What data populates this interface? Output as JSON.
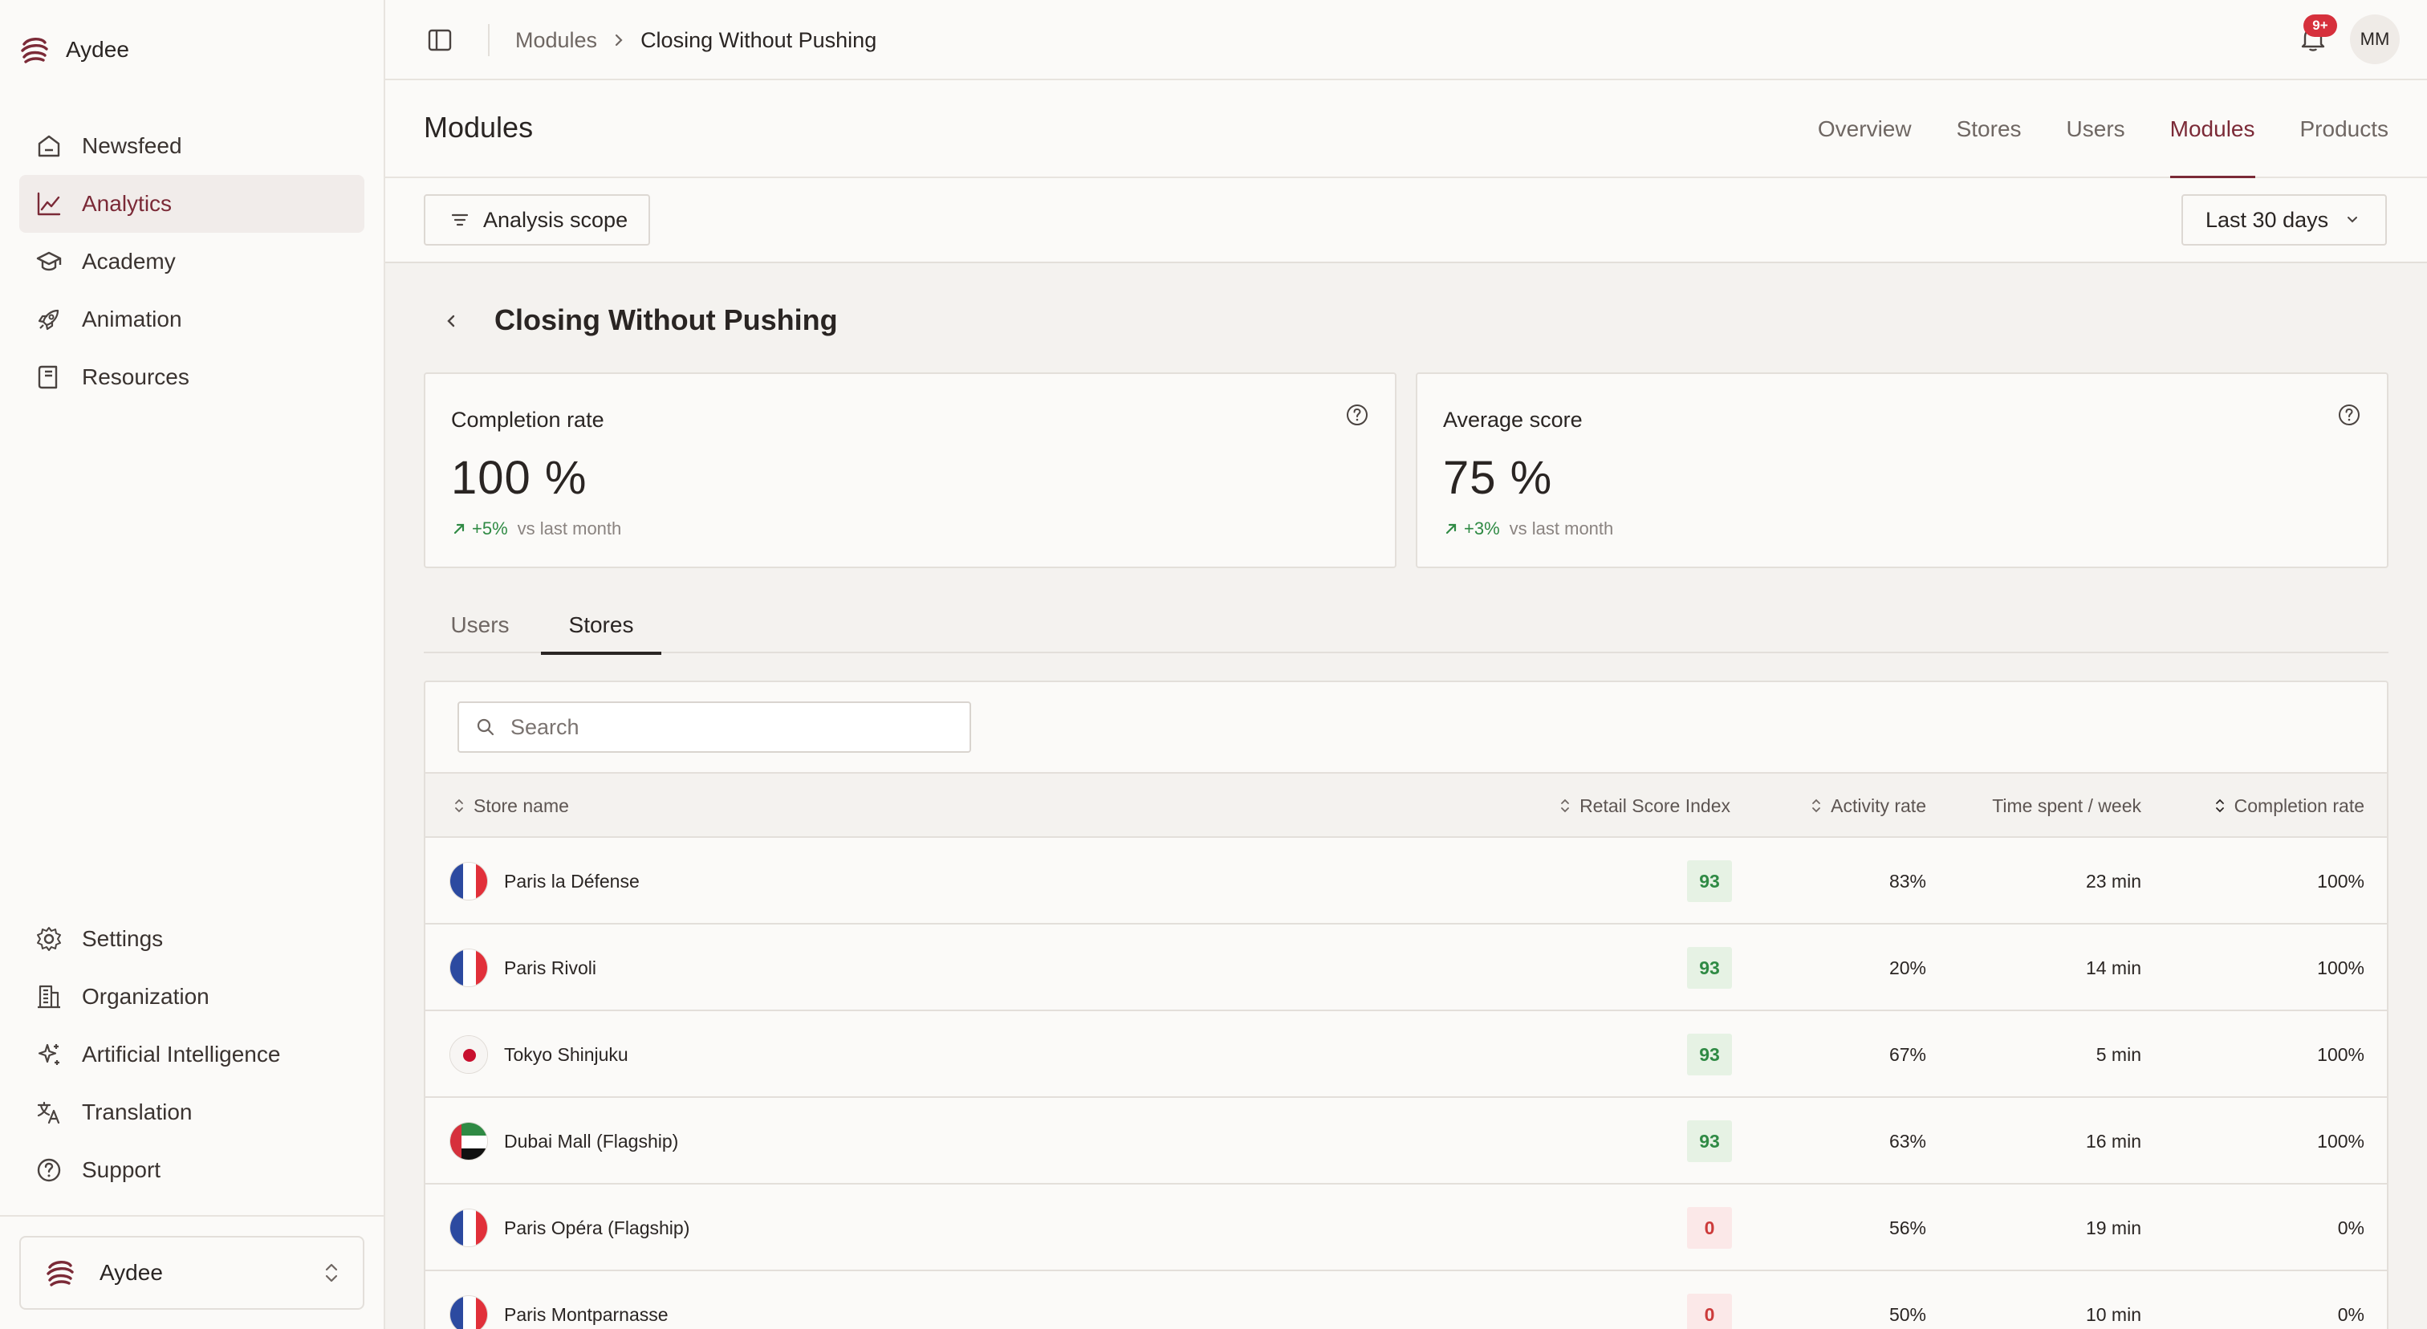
{
  "brand": {
    "name": "Aydee"
  },
  "sidebar": {
    "items": [
      {
        "label": "Newsfeed",
        "icon": "home-icon"
      },
      {
        "label": "Analytics",
        "icon": "chart-line-icon",
        "active": true
      },
      {
        "label": "Academy",
        "icon": "graduation-cap-icon"
      },
      {
        "label": "Animation",
        "icon": "rocket-icon"
      },
      {
        "label": "Resources",
        "icon": "book-icon"
      }
    ],
    "bottom_items": [
      {
        "label": "Settings",
        "icon": "gear-icon"
      },
      {
        "label": "Organization",
        "icon": "building-icon"
      },
      {
        "label": "Artificial Intelligence",
        "icon": "sparkles-icon"
      },
      {
        "label": "Translation",
        "icon": "translate-icon"
      },
      {
        "label": "Support",
        "icon": "help-circle-icon"
      }
    ],
    "org_switcher": {
      "name": "Aydee"
    }
  },
  "topbar": {
    "breadcrumb": [
      "Modules",
      "Closing Without Pushing"
    ],
    "notifications_badge": "9+",
    "avatar_initials": "MM"
  },
  "page": {
    "title": "Modules",
    "tabs": [
      {
        "label": "Overview"
      },
      {
        "label": "Stores"
      },
      {
        "label": "Users"
      },
      {
        "label": "Modules",
        "active": true
      },
      {
        "label": "Products"
      }
    ]
  },
  "filters": {
    "scope_label": "Analysis scope",
    "range_label": "Last 30 days"
  },
  "module": {
    "title": "Closing Without Pushing",
    "kpis": [
      {
        "label": "Completion rate",
        "value": "100 %",
        "delta": "+5%",
        "delta_suffix": "vs last month"
      },
      {
        "label": "Average score",
        "value": "75 %",
        "delta": "+3%",
        "delta_suffix": "vs last month"
      }
    ],
    "sub_tabs": [
      {
        "label": "Users"
      },
      {
        "label": "Stores",
        "active": true
      }
    ]
  },
  "table": {
    "search_placeholder": "Search",
    "columns": {
      "store": "Store name",
      "rsi": "Retail Score Index",
      "activity": "Activity rate",
      "time": "Time spent / week",
      "completion": "Completion rate"
    },
    "rows": [
      {
        "name": "Paris la Défense",
        "flag": "fr",
        "rsi": "93",
        "rsi_status": "good",
        "activity": "83%",
        "time": "23 min",
        "completion": "100%"
      },
      {
        "name": "Paris Rivoli",
        "flag": "fr",
        "rsi": "93",
        "rsi_status": "good",
        "activity": "20%",
        "time": "14 min",
        "completion": "100%"
      },
      {
        "name": "Tokyo Shinjuku",
        "flag": "jp",
        "rsi": "93",
        "rsi_status": "good",
        "activity": "67%",
        "time": "5 min",
        "completion": "100%"
      },
      {
        "name": "Dubai Mall (Flagship)",
        "flag": "ae",
        "rsi": "93",
        "rsi_status": "good",
        "activity": "63%",
        "time": "16 min",
        "completion": "100%"
      },
      {
        "name": "Paris Opéra (Flagship)",
        "flag": "fr",
        "rsi": "0",
        "rsi_status": "bad",
        "activity": "56%",
        "time": "19 min",
        "completion": "0%"
      },
      {
        "name": "Paris Montparnasse",
        "flag": "fr",
        "rsi": "0",
        "rsi_status": "bad",
        "activity": "50%",
        "time": "10 min",
        "completion": "0%"
      }
    ]
  },
  "colors": {
    "accent": "#7b2a37",
    "positive": "#2f8a44",
    "negative": "#cc3a3a",
    "badge": "#d6303c"
  }
}
